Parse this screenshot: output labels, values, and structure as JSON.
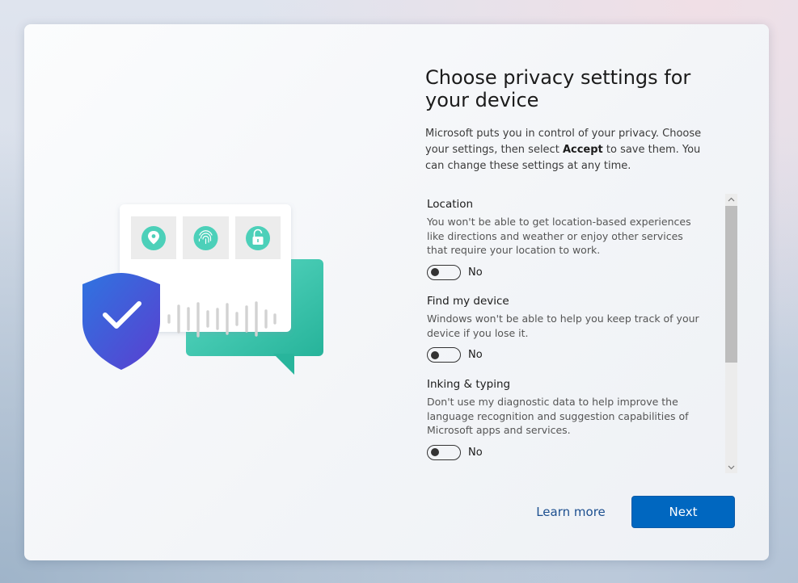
{
  "heading": "Choose privacy settings for your device",
  "intro": {
    "part1": "Microsoft puts you in control of your privacy. Choose your settings, then select ",
    "emphasis": "Accept",
    "part2": " to save them. You can change these settings at any time."
  },
  "settings": [
    {
      "title": "Location",
      "description": "You won't be able to get location-based experiences like directions and weather or enjoy other services that require your location to work.",
      "state": "No"
    },
    {
      "title": "Find my device",
      "description": "Windows won't be able to help you keep track of your device if you lose it.",
      "state": "No"
    },
    {
      "title": "Inking & typing",
      "description": "Don't use my diagnostic data to help improve the language recognition and suggestion capabilities of Microsoft apps and services.",
      "state": "No"
    }
  ],
  "buttons": {
    "learn_more": "Learn more",
    "next": "Next"
  },
  "colors": {
    "accent": "#0067c0",
    "link": "#1c4f8f",
    "teal": "#3fc9b0",
    "shield": "#3b5bdb"
  }
}
